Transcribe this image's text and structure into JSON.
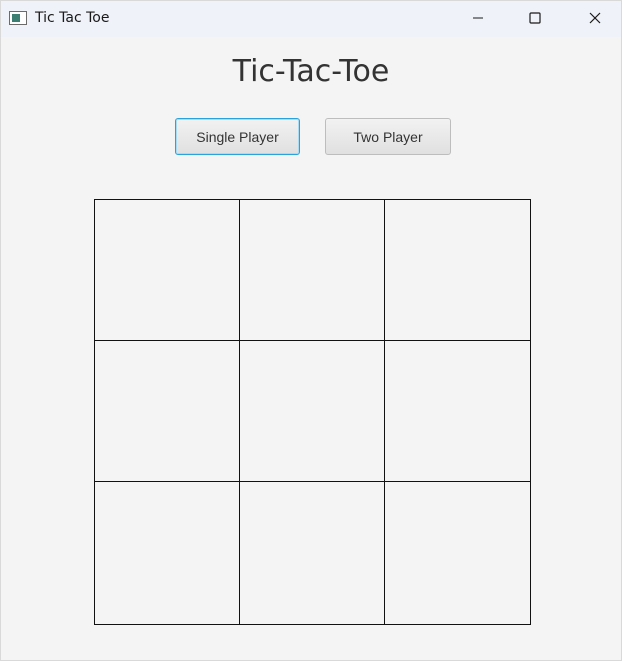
{
  "window": {
    "title": "Tic Tac Toe",
    "icon": "app-window-icon",
    "controls": [
      "minimize-icon",
      "maximize-icon",
      "close-icon"
    ]
  },
  "app": {
    "heading": "Tic-Tac-Toe"
  },
  "modes": {
    "single_label": "Single Player",
    "two_label": "Two Player",
    "focused": "Single Player"
  },
  "board": {
    "cells": [
      "",
      "",
      "",
      "",
      "",
      "",
      "",
      "",
      ""
    ]
  },
  "colors": {
    "focus_accent": "#2aa3dc",
    "grid_line": "#111111",
    "background": "#f4f4f4"
  }
}
